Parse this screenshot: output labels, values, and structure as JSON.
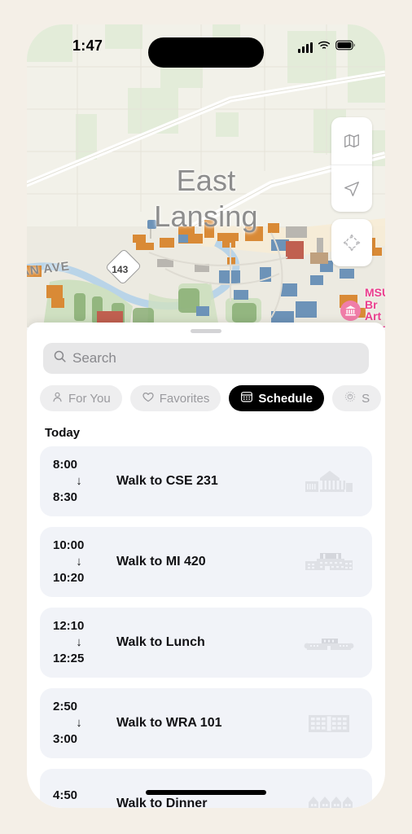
{
  "status_bar": {
    "time": "1:47",
    "cellular_icon": "signal-bars-icon",
    "wifi_icon": "wifi-icon",
    "battery_icon": "battery-full-icon"
  },
  "map": {
    "city_label": "East\nLansing",
    "street_label": "AN AVE",
    "route_shield": "143",
    "poi": {
      "name": "MSU Br\nArt Mus",
      "icon": "museum-icon",
      "color": "#eb3f8f"
    },
    "controls": [
      {
        "name": "map-layers-icon"
      },
      {
        "name": "location-arrow-icon"
      },
      {
        "name": "three-d-view-icon"
      }
    ]
  },
  "sheet": {
    "grabber": "drag-handle",
    "search": {
      "placeholder": "Search",
      "value": "",
      "icon": "search-icon"
    },
    "chips": [
      {
        "label": "For You",
        "icon": "person-icon",
        "active": false
      },
      {
        "label": "Favorites",
        "icon": "heart-icon",
        "active": false
      },
      {
        "label": "Schedule",
        "icon": "calendar-icon",
        "active": true
      },
      {
        "label": "S",
        "icon": "gear-icon",
        "active": false
      }
    ],
    "section_title": "Today",
    "events": [
      {
        "start": "8:00",
        "arrow": "↓",
        "end": "8:30",
        "title": "Walk to CSE 231",
        "icon": "classical-building-icon"
      },
      {
        "start": "10:00",
        "arrow": "↓",
        "end": "10:20",
        "title": "Walk to MI 420",
        "icon": "modern-building-icon"
      },
      {
        "start": "12:10",
        "arrow": "↓",
        "end": "12:25",
        "title": "Walk to Lunch",
        "icon": "long-building-icon"
      },
      {
        "start": "2:50",
        "arrow": "↓",
        "end": "3:00",
        "title": "Walk to WRA 101",
        "icon": "grid-building-icon"
      },
      {
        "start": "4:50",
        "arrow": "↓",
        "end": "",
        "title": "Walk to Dinner",
        "icon": "houses-icon"
      }
    ]
  },
  "colors": {
    "page_background": "#f4efe7",
    "accent_selected": "#000000",
    "card_background": "#f1f3f8",
    "poi_pink": "#eb3f8f"
  }
}
